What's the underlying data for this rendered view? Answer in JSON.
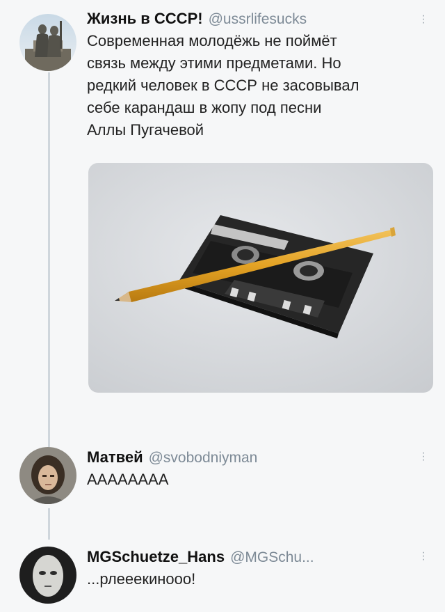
{
  "tweets": [
    {
      "name": "Жизнь в СССР!",
      "handle": "@ussrlifesucks",
      "lines": [
        "Современная молодёжь не поймёт",
        "связь между этими предметами. Но",
        "редкий человек в СССР не засовывал",
        "себе карандаш в жопу под песни",
        "Аллы Пугачевой"
      ]
    },
    {
      "name": "Матвей",
      "handle": "@svobodniyman",
      "text": "АААААААА"
    },
    {
      "name": "MGSchuetze_Hans",
      "handle": "@MGSchu...",
      "text": "...рлееекинооо!"
    }
  ],
  "icons": {
    "more": "more-options-icon"
  },
  "colors": {
    "background": "#f6f7f8",
    "thread_line": "#cfd6dc",
    "handle": "#7d8a96"
  }
}
